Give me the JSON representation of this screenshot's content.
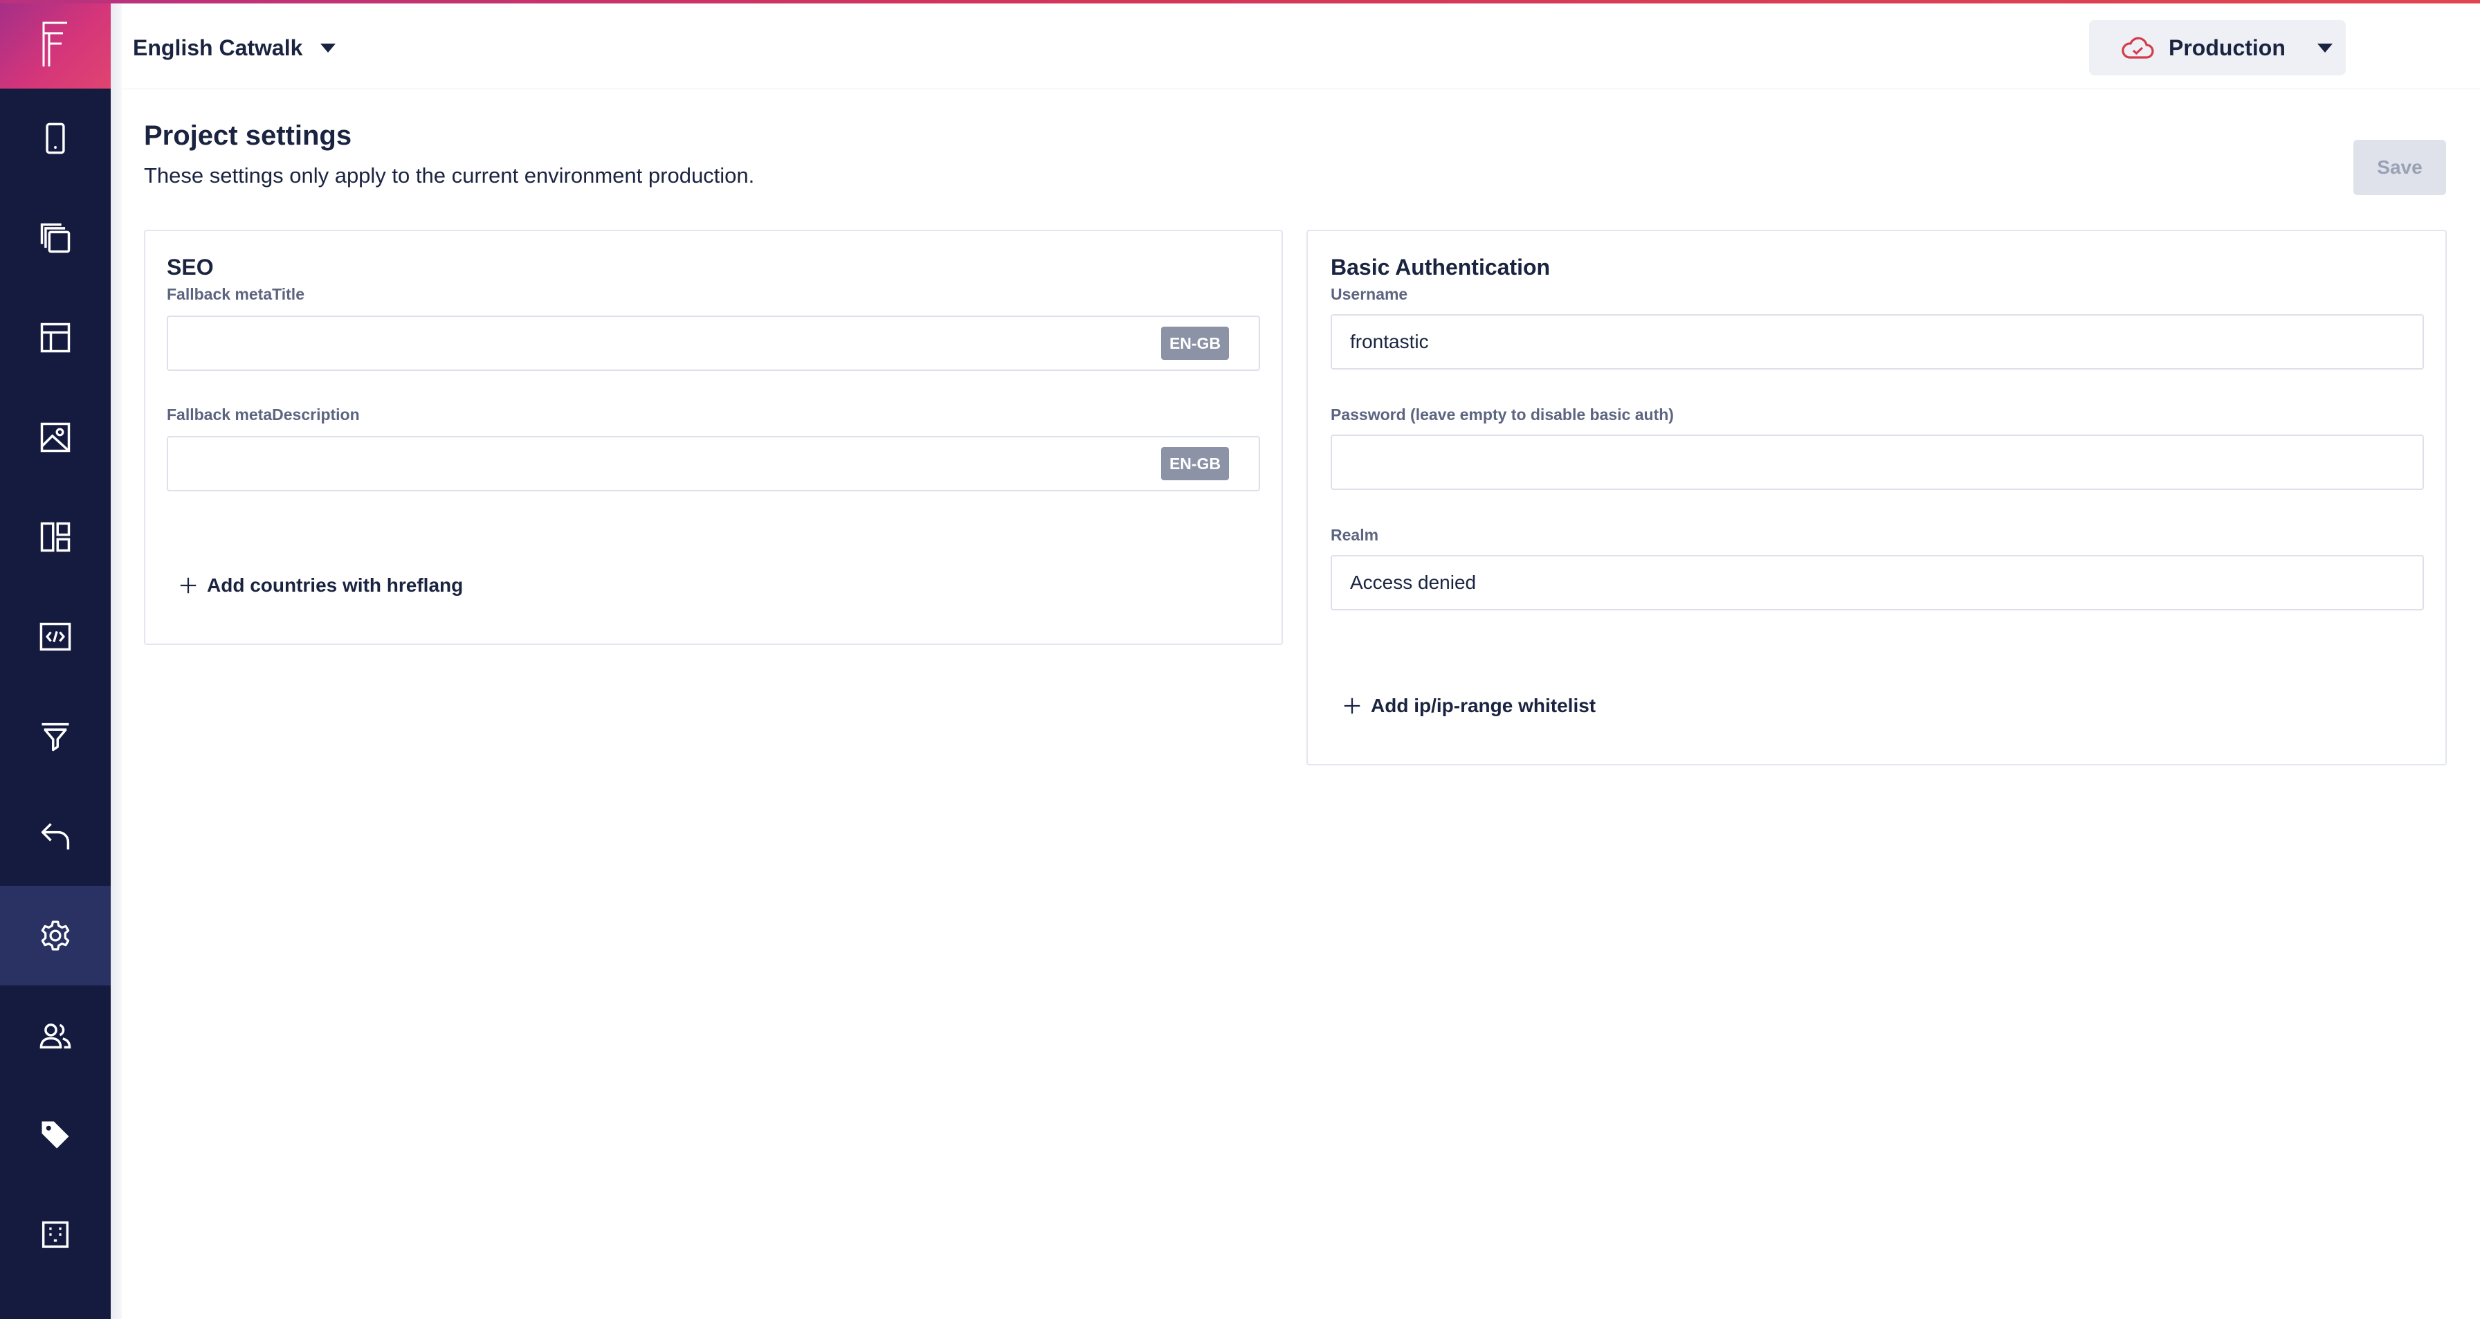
{
  "app": {
    "project_name": "English Catwalk",
    "environment": "Production",
    "brand_color": "#d4357a",
    "sidebar_color": "#151b3f"
  },
  "sidebar": {
    "items": [
      {
        "icon": "mobile-icon",
        "active": false
      },
      {
        "icon": "copy-pages-icon",
        "active": false
      },
      {
        "icon": "layout-icon",
        "active": false
      },
      {
        "icon": "image-icon",
        "active": false
      },
      {
        "icon": "dashboard-icon",
        "active": false
      },
      {
        "icon": "code-icon",
        "active": false
      },
      {
        "icon": "filter-icon",
        "active": false
      },
      {
        "icon": "undo-icon",
        "active": false
      },
      {
        "icon": "gear-icon",
        "active": true
      },
      {
        "icon": "users-icon",
        "active": false
      },
      {
        "icon": "tag-icon",
        "active": false
      },
      {
        "icon": "building-icon",
        "active": false
      }
    ]
  },
  "page": {
    "title": "Project settings",
    "subtitle": "These settings only apply to the current environment production.",
    "save_label": "Save"
  },
  "seo": {
    "title": "SEO",
    "meta_title_label": "Fallback metaTitle",
    "meta_title_value": "",
    "meta_title_lang": "EN-GB",
    "meta_description_label": "Fallback metaDescription",
    "meta_description_value": "",
    "meta_description_lang": "EN-GB",
    "add_label": "Add countries with hreflang"
  },
  "auth": {
    "title": "Basic Authentication",
    "username_label": "Username",
    "username_value": "frontastic",
    "password_label": "Password (leave empty to disable basic auth)",
    "password_value": "",
    "realm_label": "Realm",
    "realm_value": "Access denied",
    "add_label": "Add ip/ip-range whitelist"
  }
}
